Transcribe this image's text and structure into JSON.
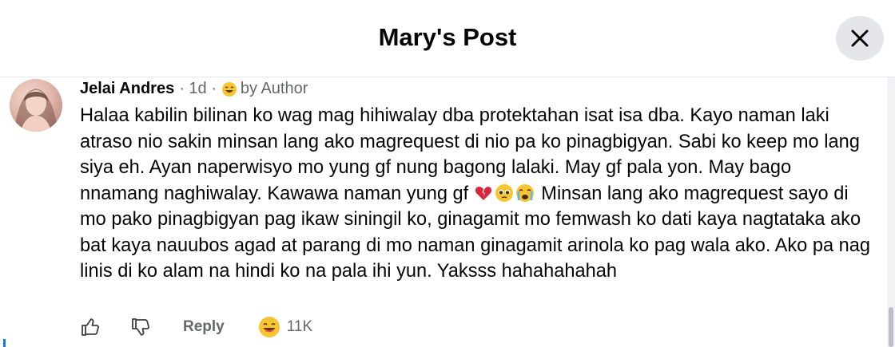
{
  "header": {
    "title": "Mary's Post"
  },
  "comment": {
    "author": "Jelai Andres",
    "meta": "· 1d ·",
    "badge_label": "by Author",
    "text_before_emojis": "Halaa kabilin bilinan ko wag mag hihiwalay dba protektahan isat isa dba. Kayo naman laki atraso nio sakin minsan lang ako magrequest di nio pa ko pinagbigyan. Sabi ko keep mo lang siya eh. Ayan naperwisyo mo yung gf nung bagong lalaki. May gf pala yon. May bago nnamang naghiwalay. Kawawa naman yung gf ",
    "text_after_emojis": " Minsan lang ako magrequest sayo di mo pako pinagbigyan pag ikaw siningil ko, ginagamit mo femwash ko dati kaya nagtataka ako bat kaya nauubos agad at parang di mo naman ginagamit arinola ko pag wala ako. Ako pa nag linis di ko alam na hindi ko na pala ihi yun. Yaksss hahahahahah",
    "inline_emojis": [
      "broken-heart-icon",
      "pleading-face-icon",
      "crying-face-icon"
    ],
    "actions": {
      "reply_label": "Reply",
      "reaction_icon": "laughing-face-icon",
      "reaction_count": "11K"
    }
  },
  "colors": {
    "text": "#050505",
    "secondary": "#65676b",
    "close_bg": "#e4e6eb",
    "divider": "#e4e6eb",
    "accent": "#1877f2"
  }
}
